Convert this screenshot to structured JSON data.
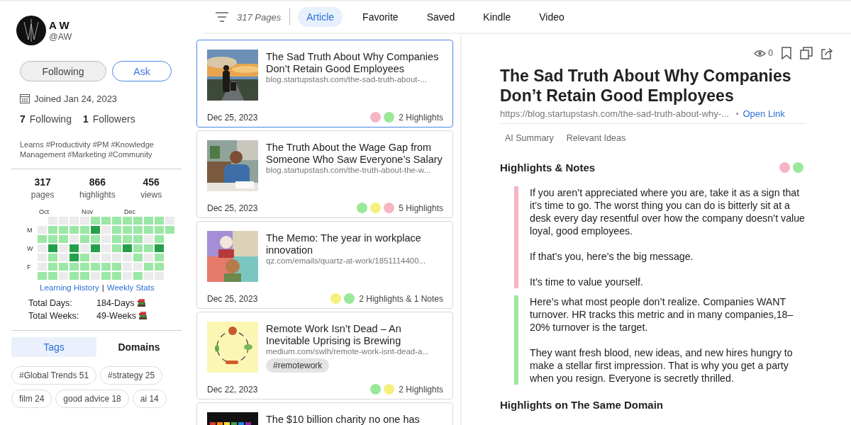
{
  "profile": {
    "name": "A W",
    "handle": "@AW",
    "buttons": [
      {
        "label": "Following",
        "kind": "following"
      },
      {
        "label": "Ask",
        "kind": "ask"
      }
    ],
    "joined": "Joined Jan 24, 2023",
    "following_count": "7",
    "following_label": "Following",
    "followers_count": "1",
    "followers_label": "Followers",
    "bio": "Learns #Productivity #PM #Knowledge Management #Marketing #Community"
  },
  "stats": [
    {
      "value": "317",
      "label": "pages"
    },
    {
      "value": "866",
      "label": "highlights"
    },
    {
      "value": "456",
      "label": "views"
    }
  ],
  "heatmap": {
    "rows": [
      {
        "cells": [
          {
            "month": "Oct"
          },
          {
            "color": "#ebebeb"
          },
          {
            "color": "#ebebeb"
          },
          {
            "color": "#ebebeb"
          },
          {
            "color": "#ebebeb",
            "month": "Nov"
          },
          {
            "color": "#9be8a6"
          },
          {
            "color": "#9be8a6"
          },
          {
            "color": "#9be8a6"
          },
          {
            "color": "#9be8a6",
            "month": "Dec"
          },
          {
            "color": "#9be8a6"
          },
          {
            "color": "#9be8a6"
          },
          {
            "color": "#9be8a6"
          },
          {
            "color": "#ebebeb"
          }
        ]
      },
      {
        "label": "M",
        "cells": [
          {
            "color": "#ebebeb"
          },
          {
            "color": "#9be8a6"
          },
          {
            "color": "#9be8a6"
          },
          {
            "color": "#9be8a6"
          },
          {
            "color": "#9be8a6"
          },
          {
            "color": "#24a04a"
          },
          {
            "color": "#ebebeb"
          },
          {
            "color": "#9be8a6"
          },
          {
            "color": "#9be8a6"
          },
          {
            "color": "#9be8a6"
          },
          {
            "color": "#9be8a6"
          },
          {
            "color": "#9be8a6"
          },
          {
            "color": "#9be8a6"
          }
        ]
      },
      {
        "cells": [
          {
            "color": "#9be8a6"
          },
          {
            "color": "#9be8a6"
          },
          {
            "color": "#9be8a6"
          },
          {
            "color": "#ebebeb"
          },
          {
            "color": "#9be8a6"
          },
          {
            "color": "#9be8a6"
          },
          {
            "color": "#ebebeb"
          },
          {
            "color": "#9be8a6"
          },
          {
            "color": "#9be8a6"
          },
          {
            "color": "#9be8a6"
          },
          {
            "color": "#ebebeb"
          },
          {
            "color": "#9be8a6"
          },
          null
        ]
      },
      {
        "label": "W",
        "cells": [
          {
            "color": "#ebebeb"
          },
          {
            "color": "#24a04a"
          },
          {
            "color": "#ebebeb"
          },
          {
            "color": "#24a04a"
          },
          {
            "color": "#ebebeb"
          },
          {
            "color": "#24a04a"
          },
          {
            "color": "#ebebeb"
          },
          {
            "color": "#9be8a6"
          },
          {
            "color": "#24a04a"
          },
          {
            "color": "#9be8a6"
          },
          {
            "color": "#9be8a6"
          },
          {
            "color": "#24a04a"
          },
          null
        ]
      },
      {
        "cells": [
          {
            "color": "#ebebeb"
          },
          {
            "color": "#9be8a6"
          },
          {
            "color": "#ebebeb"
          },
          {
            "color": "#24a04a"
          },
          {
            "color": "#9be8a6"
          },
          {
            "color": "#ebebeb"
          },
          {
            "color": "#ebebeb"
          },
          {
            "color": "#ebebeb"
          },
          {
            "color": "#ebebeb"
          },
          {
            "color": "#9be8a6"
          },
          {
            "color": "#ebebeb"
          },
          {
            "color": "#9be8a6"
          },
          null
        ]
      },
      {
        "label": "F",
        "cells": [
          {
            "color": "#ebebeb"
          },
          {
            "color": "#9be8a6"
          },
          {
            "color": "#9be8a6"
          },
          {
            "color": "#9be8a6"
          },
          {
            "color": "#9be8a6"
          },
          {
            "color": "#9be8a6"
          },
          {
            "color": "#9be8a6"
          },
          {
            "color": "#9be8a6"
          },
          {
            "color": "#ebebeb"
          },
          {
            "color": "#ebebeb"
          },
          {
            "color": "#9be8a6"
          },
          {
            "color": "#9be8a6"
          },
          null
        ]
      },
      {
        "cells": [
          {
            "color": "#9be8a6"
          },
          {
            "color": "#9be8a6"
          },
          {
            "color": "#ebebeb"
          },
          {
            "color": "#9be8a6"
          },
          {
            "color": "#9be8a6"
          },
          {
            "color": "#ebebeb"
          },
          {
            "color": "#9be8a6"
          },
          {
            "color": "#9be8a6"
          },
          {
            "color": "#ebebeb"
          },
          {
            "color": "#9be8a6"
          },
          {
            "color": "#ebebeb"
          },
          {
            "color": "#ebebeb"
          },
          null
        ]
      }
    ]
  },
  "history_links": [
    "Learning History",
    "|",
    "Weekly Stats"
  ],
  "totals": [
    {
      "label": "Total Days:",
      "value": "184-Days"
    },
    {
      "label": "Total Weeks:",
      "value": "49-Weeks"
    }
  ],
  "tag_tabs": [
    {
      "label": "Tags",
      "selected": true
    },
    {
      "label": "Domains",
      "selected": false
    }
  ],
  "tags": [
    "#Global Trends 51",
    "#strategy 25",
    "film 24",
    "good advice 18",
    "ai 14"
  ],
  "toolbar": {
    "count": "317 Pages",
    "tabs": [
      {
        "label": "Article",
        "selected": true
      },
      {
        "label": "Favorite",
        "selected": false
      },
      {
        "label": "Saved",
        "selected": false
      },
      {
        "label": "Kindle",
        "selected": false
      },
      {
        "label": "Video",
        "selected": false
      }
    ]
  },
  "articles": [
    {
      "title": "The Sad Truth About Why Companies Don’t Retain Good Employees",
      "url": "blog.startupstash.com/the-sad-truth-about-...",
      "date": "Dec 25, 2023",
      "colors": [
        {
          "color": "#f7b5c3"
        },
        {
          "color": "#9be89b"
        }
      ],
      "summary": "2 Highlights",
      "selected": true
    },
    {
      "title": "The Truth About the Wage Gap from Someone Who Saw Everyone’s Salary",
      "url": "blog.startupstash.com/the-truth-about-the-w...",
      "date": "Dec 25, 2023",
      "colors": [
        {
          "color": "#9be89b"
        },
        {
          "color": "#f5ef7d"
        },
        {
          "color": "#f7b5c3"
        }
      ],
      "summary": "5 Highlights",
      "selected": false
    },
    {
      "title": "The Memo: The year in workplace innovation",
      "url": "qz.com/emails/quartz-at-work/1851114400...",
      "date": "Dec 25, 2023",
      "colors": [
        {
          "color": "#f5ef7d"
        },
        {
          "color": "#9be89b"
        }
      ],
      "summary": "2 Highlights & 1 Notes",
      "selected": false
    },
    {
      "title": "Remote Work Isn’t Dead – An Inevitable Uprising is Brewing",
      "url": "medium.com/swlh/remote-work-isnt-dead-a...",
      "tag": "#remotework",
      "date": "Dec 22, 2023",
      "colors": [
        {
          "color": "#9be89b"
        },
        {
          "color": "#f5ef7d"
        }
      ],
      "summary": "2 Highlights",
      "selected": false
    },
    {
      "title": "The $10 billion charity no one has",
      "selected": false
    }
  ],
  "detail": {
    "views": "0",
    "title": "The Sad Truth About Why Companies Don’t Retain Good Employees",
    "url": "https://blog.startupstash.com/the-sad-truth-about-why-...",
    "link_dot": "•",
    "open_link": "Open Link",
    "subtabs": [
      {
        "label": "AI Summary",
        "selected": false
      },
      {
        "label": "Relevant Ideas",
        "selected": false
      }
    ],
    "section": "Highlights & Notes",
    "section_colors": [
      {
        "color": "#f7b5c3"
      },
      {
        "color": "#9be89b"
      }
    ],
    "highlights": [
      {
        "color": "#f7b5c3",
        "paragraphs": [
          "If you aren’t appreciated where you are, take it as a sign that it’s time to go. The worst thing you can do is bitterly sit at a desk every day resentful over how the company doesn’t value loyal, good employees.",
          "If that’s you, here’s the big message.",
          "It’s time to value yourself."
        ]
      },
      {
        "color": "#9be89b",
        "paragraphs": [
          "Here’s what most people don’t realize. Companies WANT turnover. HR tracks this metric and in many companies,18–20% turnover is the target.",
          "They want fresh blood, new ideas, and new hires hungry to make a stellar first impression. That is why you get a party when you resign. Everyone is secretly thrilled."
        ]
      }
    ],
    "next_section": "Highlights on The Same Domain"
  }
}
